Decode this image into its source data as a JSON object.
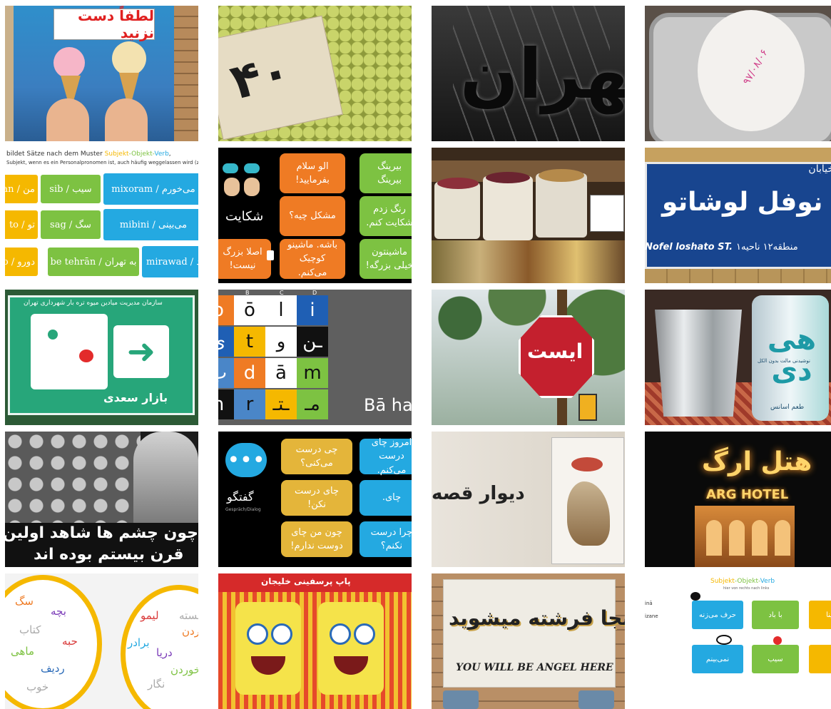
{
  "gallery": {
    "tile1": {
      "sign": "لطفاً دست نزنید"
    },
    "tile2": {
      "price": "۴۰"
    },
    "tile3": {
      "letters": "تهران"
    },
    "tile4": {
      "stamp": "۹۷/۰۸/۰۶"
    },
    "tile5": {
      "intro_plain": "bildet Sätze nach dem Muster",
      "w1": "Subjekt",
      "w2": "-Objekt-",
      "w3": "Verb",
      "dot": ",",
      "line2": "Subjekt, wenn es ein Personalpronomen ist, auch häufig weggelassen wird (z.B. (بیش بیایه",
      "rows": [
        [
          "man / من",
          "sib / سیب",
          "mixoram / می‌خورم"
        ],
        [
          "to / تو",
          "sag / سگ",
          "mibini / می‌بینی"
        ],
        [
          "do / دورو",
          "be tehrān / به تهران",
          "mirawad / می‌رود"
        ]
      ]
    },
    "tile6": {
      "title": "شکایت",
      "bubbles": [
        "الو سلام\nبفرمایید!",
        "مشکل چیه؟",
        "باشه. ماشینو\nکوچیک می‌کنم.",
        "اصلا بزرگ\nنیست!",
        "بیرینگ\nبیرینگ",
        "رنگ زدم\nشکایت کنم.",
        "ماشینتون\nخیلی بزرگه!"
      ],
      "small_icon": "⬛"
    },
    "tile7": {
      "cols": [
        "B",
        "C",
        "D"
      ],
      "cells": [
        [
          "o",
          "ō",
          "ا",
          "i"
        ],
        [
          "ی",
          "t",
          "و",
          "ـن"
        ],
        [
          "ب",
          "d",
          "ā",
          "m"
        ],
        [
          "h",
          "r",
          "ـتـ",
          "مـ"
        ]
      ],
      "caption": "Bā ha"
    },
    "tile8": {
      "caption": ""
    },
    "tile9": {
      "line1": "خیابان",
      "line2": "نوفل لوشاتو",
      "line3": "منطقه۱۲ ناحیه۱",
      "latin": "Nofel loshato ST."
    },
    "tile10": {
      "org": "سازمان مدیریت میادین میوه تره بار شهرداری تهران",
      "place": "بازار سعدی"
    },
    "tile11": {
      "stop": "ایست"
    },
    "tile12": {
      "brand": "هی دی",
      "line": "نوشیدنی مالت بدون الکل",
      "flavor": "طعم اسانس"
    },
    "tile13": {
      "line1": "چون چشم ها شاهد اولین نسل کشی",
      "line2": "قرن بیستم بوده اند"
    },
    "tile14": {
      "title": "گفتگو",
      "sub": "Gespräch/Dialog",
      "bubbles": [
        "چی درست\nمی‌کنی؟",
        "چای درست\nنکن!",
        "چون من چای\nدوست ندارم!",
        "امروز چای\nدرست می‌کنم.",
        "چای.",
        "چرا درست\nنکنم؟"
      ]
    },
    "tile15": {
      "text": "دیوار قصه",
      "poster": "سیمرغ"
    },
    "tile16": {
      "fa": "هتل ارگ",
      "en": "ARG HOTEL"
    },
    "tile17": {
      "left_words": [
        "سگ",
        "بچه",
        "کتاب",
        "حبه",
        "ماهی",
        "ردیف",
        "خوب"
      ],
      "right_words": [
        "لیمو",
        "کردن",
        "برادر",
        "دریا",
        "خوردن",
        "نگار",
        "خسته"
      ]
    },
    "tile18": {
      "banner": "پاپ پرسفینی خلیجان"
    },
    "tile19": {
      "fa": "شما اینجا فرشته میشوید",
      "en": "YOU WILL BE ANGEL HERE"
    },
    "tile20": {
      "title_a": "Subjekt",
      "title_b": "-Objekt-",
      "title_c": "Verb",
      "subtitle": "hier von rechts nach links",
      "left_a": "inā",
      "left_b": "izane",
      "boxes": [
        "حرف می‌زنه",
        "با باد",
        "تینا",
        "نمی‌بینم",
        "سیب",
        ""
      ]
    }
  },
  "colors": {
    "orange": "#EF7B24",
    "green": "#7DC242",
    "blue": "#24A9E1",
    "yellow": "#F5B800",
    "mustard": "#E4B53A"
  }
}
